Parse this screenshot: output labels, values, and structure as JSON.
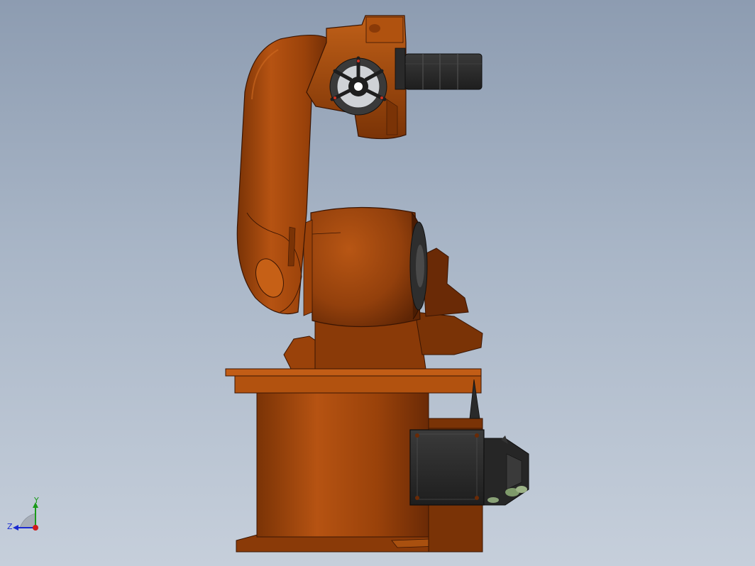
{
  "viewport": {
    "background_top": "#8d9cb1",
    "background_bottom": "#c6cfdb"
  },
  "model": {
    "body_color": "#a8490b",
    "shadow_color": "#6a2a06",
    "highlight_color": "#c85c1a",
    "dark_part_color": "#2b2b2b"
  },
  "triad": {
    "y_label": "Y",
    "z_label": "Z",
    "y_color": "#1a9a1a",
    "z_color": "#1a2ad0",
    "x_color": "#d01a1a"
  }
}
